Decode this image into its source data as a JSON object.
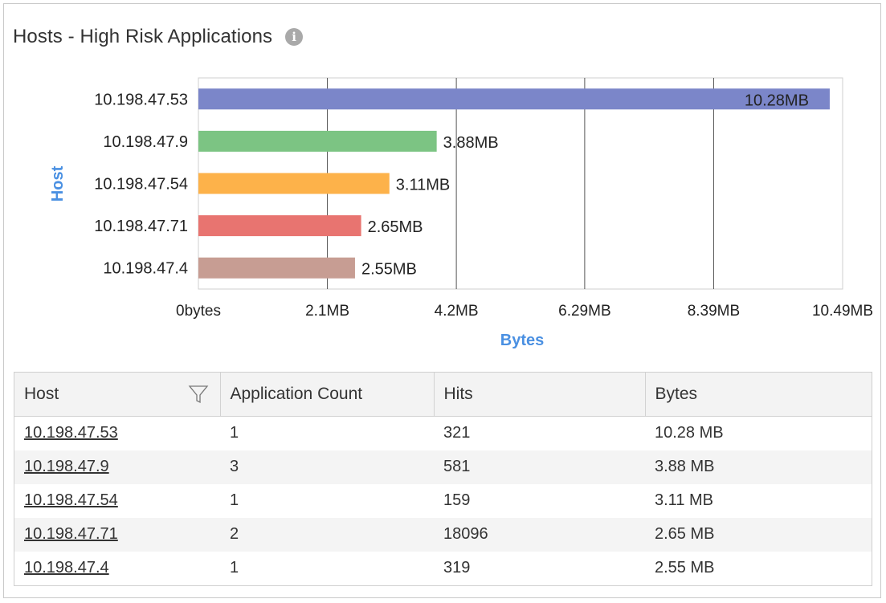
{
  "widget": {
    "title": "Hosts - High Risk Applications",
    "info_icon": "info-circle-icon"
  },
  "chart_data": {
    "type": "bar",
    "orientation": "horizontal",
    "xlabel": "Bytes",
    "ylabel": "Host",
    "categories": [
      "10.198.47.53",
      "10.198.47.9",
      "10.198.47.54",
      "10.198.47.71",
      "10.198.47.4"
    ],
    "values": [
      10.28,
      3.88,
      3.11,
      2.65,
      2.55
    ],
    "value_labels": [
      "10.28MB",
      "3.88MB",
      "3.11MB",
      "2.65MB",
      "2.55MB"
    ],
    "units": "MB",
    "colors": [
      "#7b86c9",
      "#7cc483",
      "#fdb24a",
      "#e87470",
      "#c79d93"
    ],
    "xlim": [
      0,
      10.49
    ],
    "x_ticks": [
      0,
      2.1,
      4.2,
      6.29,
      8.39,
      10.49
    ],
    "x_tick_labels": [
      "0bytes",
      "2.1MB",
      "4.2MB",
      "6.29MB",
      "8.39MB",
      "10.49MB"
    ],
    "grid": true,
    "axis_label_color": "#4a90e2"
  },
  "table": {
    "columns": [
      "Host",
      "Application Count",
      "Hits",
      "Bytes"
    ],
    "filter_icon": "filter-funnel-icon",
    "rows": [
      {
        "host": "10.198.47.53",
        "app_count": "1",
        "hits": "321",
        "bytes": "10.28 MB"
      },
      {
        "host": "10.198.47.9",
        "app_count": "3",
        "hits": "581",
        "bytes": "3.88 MB"
      },
      {
        "host": "10.198.47.54",
        "app_count": "1",
        "hits": "159",
        "bytes": "3.11 MB"
      },
      {
        "host": "10.198.47.71",
        "app_count": "2",
        "hits": "18096",
        "bytes": "2.65 MB"
      },
      {
        "host": "10.198.47.4",
        "app_count": "1",
        "hits": "319",
        "bytes": "2.55 MB"
      }
    ]
  }
}
